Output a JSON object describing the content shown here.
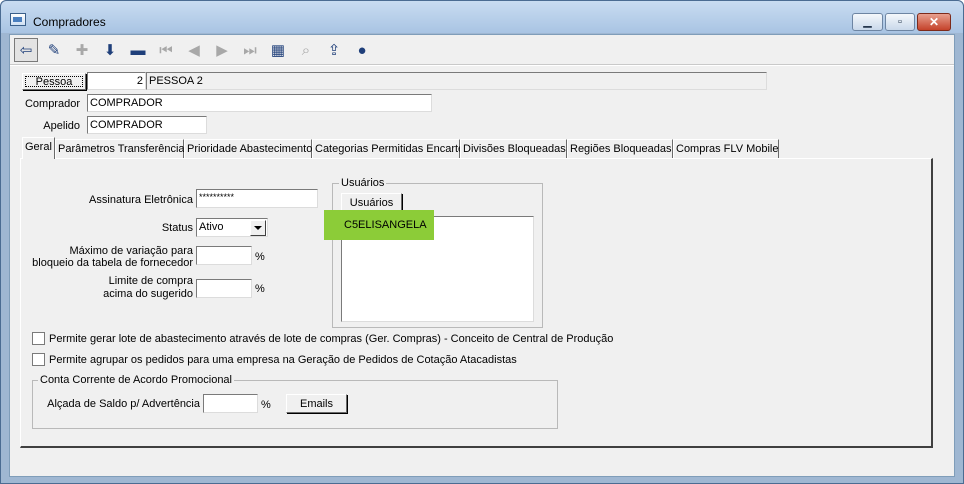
{
  "window": {
    "title": "Compradores"
  },
  "toolbar": {
    "buttons": [
      {
        "icon": "exit-door-icon",
        "glyph": "⇦",
        "enabled": true
      },
      {
        "icon": "pencil-icon",
        "glyph": "✎",
        "enabled": true
      },
      {
        "icon": "add-icon",
        "glyph": "✚",
        "enabled": false
      },
      {
        "icon": "save-icon",
        "glyph": "⬇",
        "enabled": true
      },
      {
        "icon": "delete-icon",
        "glyph": "▬",
        "enabled": true
      },
      {
        "icon": "first-record-icon",
        "glyph": "⏮",
        "enabled": false
      },
      {
        "icon": "prev-record-icon",
        "glyph": "◀",
        "enabled": false
      },
      {
        "icon": "next-record-icon",
        "glyph": "▶",
        "enabled": false
      },
      {
        "icon": "last-record-icon",
        "glyph": "⏭",
        "enabled": false
      },
      {
        "icon": "grid-icon",
        "glyph": "▦",
        "enabled": true
      },
      {
        "icon": "binoculars-icon",
        "glyph": "⌕",
        "enabled": false
      },
      {
        "icon": "open-icon",
        "glyph": "⇪",
        "enabled": true
      },
      {
        "icon": "user-icon",
        "glyph": "●",
        "enabled": true
      }
    ]
  },
  "header": {
    "pessoa_button": "Pessoa",
    "pessoa_code": "2",
    "pessoa_name": "PESSOA 2",
    "comprador_label": "Comprador",
    "comprador_value": "COMPRADOR",
    "apelido_label": "Apelido",
    "apelido_value": "COMPRADOR"
  },
  "tabs": [
    {
      "label": "Geral",
      "active": true
    },
    {
      "label": "Parâmetros Transferência",
      "active": false
    },
    {
      "label": "Prioridade Abastecimento",
      "active": false
    },
    {
      "label": "Categorias Permitidas Encarte",
      "active": false
    },
    {
      "label": "Divisões Bloqueadas",
      "active": false
    },
    {
      "label": "Regiões Bloqueadas",
      "active": false
    },
    {
      "label": "Compras FLV Mobile",
      "active": false
    }
  ],
  "geral": {
    "assinatura_label": "Assinatura Eletrônica",
    "assinatura_value": "**********",
    "status_label": "Status",
    "status_value": "Ativo",
    "max_variacao_label_1": "Máximo de variação para",
    "max_variacao_label_2": "bloqueio da tabela de fornecedor",
    "max_variacao_value": "",
    "limite_label_1": "Limite de compra",
    "limite_label_2": "acima do sugerido",
    "limite_value": "",
    "percent": "%",
    "usuarios_group_title": "Usuários",
    "usuarios_button": "Usuários",
    "usuarios_list": [
      "C5ELISANGELA"
    ],
    "check_lote": "Permite gerar lote de abastecimento através de lote de compras  (Ger. Compras) - Conceito de Central de Produção",
    "check_agrupar": "Permite agrupar os pedidos para uma empresa na Geração de Pedidos de Cotação Atacadistas",
    "conta_group_title": "Conta Corrente de Acordo Promocional",
    "alcada_label": "Alçada de Saldo p/ Advertência",
    "alcada_value": "",
    "emails_button": "Emails"
  },
  "colors": {
    "titlebar": "#a9c4e3",
    "highlight": "#8ccc38",
    "close": "#c4422a"
  }
}
